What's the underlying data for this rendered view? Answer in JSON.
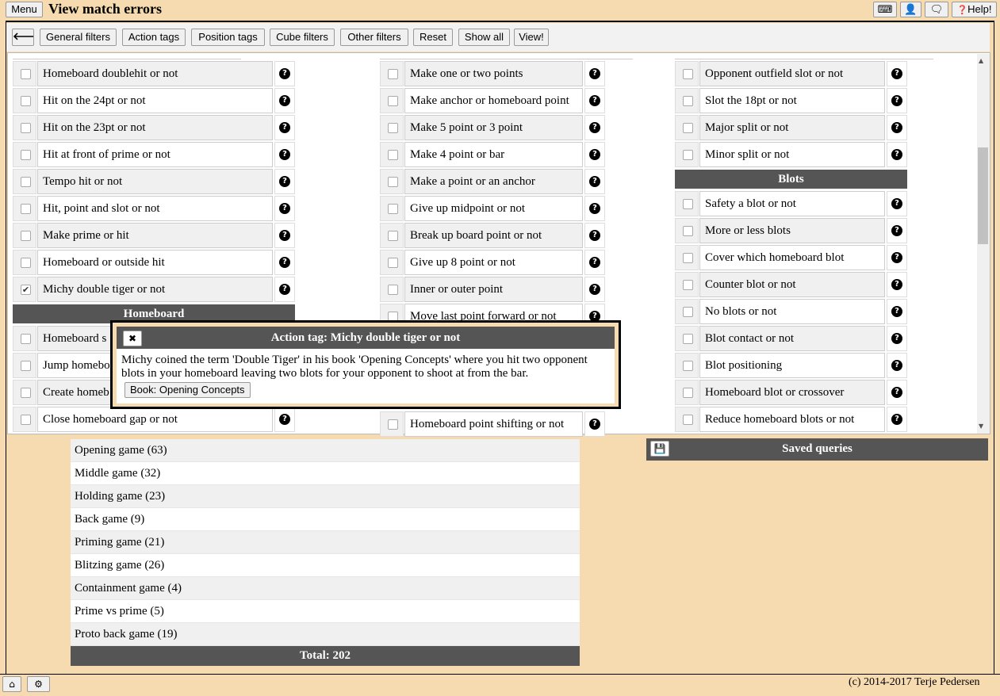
{
  "header": {
    "menu_label": "Menu",
    "title": "View match errors",
    "keyboard_icon": "keyboard-icon",
    "user_icon": "user-icon",
    "chat_icon": "chat-icon",
    "help_label": "Help!"
  },
  "toolbar": {
    "back_icon": "arrow-left-icon",
    "buttons": [
      "General filters",
      "Action tags",
      "Position tags",
      "Cube filters",
      "Other filters",
      "Reset",
      "Show all",
      "View!"
    ]
  },
  "col1": {
    "rows": [
      {
        "label": "Homeboard doublehit or not",
        "checked": false
      },
      {
        "label": "Hit on the 24pt or not",
        "checked": false
      },
      {
        "label": "Hit on the 23pt or not",
        "checked": false
      },
      {
        "label": "Hit at front of prime or not",
        "checked": false
      },
      {
        "label": "Tempo hit or not",
        "checked": false
      },
      {
        "label": "Hit, point and slot or not",
        "checked": false
      },
      {
        "label": "Make prime or hit",
        "checked": false
      },
      {
        "label": "Homeboard or outside hit",
        "checked": false
      },
      {
        "label": "Michy double tiger or not",
        "checked": true
      }
    ],
    "section": "Homeboard",
    "rows2": [
      {
        "label": "Homeboard s",
        "checked": false
      },
      {
        "label": "Jump homebo",
        "checked": false
      },
      {
        "label": "Create homeb",
        "checked": false
      },
      {
        "label": "Close homeboard gap or not",
        "checked": false
      }
    ]
  },
  "col2": {
    "rows": [
      {
        "label": "Make one or two points",
        "checked": false
      },
      {
        "label": "Make anchor or homeboard point",
        "checked": false
      },
      {
        "label": "Make 5 point or 3 point",
        "checked": false
      },
      {
        "label": "Make 4 point or bar",
        "checked": false
      },
      {
        "label": "Make a point or an anchor",
        "checked": false
      },
      {
        "label": "Give up midpoint or not",
        "checked": false
      },
      {
        "label": "Break up board point or not",
        "checked": false
      },
      {
        "label": "Give up 8 point or not",
        "checked": false
      },
      {
        "label": "Inner or outer point",
        "checked": false
      },
      {
        "label": "Move last point forward or not",
        "checked": false
      }
    ],
    "last": {
      "label": "Homeboard point shifting or not",
      "checked": false
    }
  },
  "col3": {
    "rows": [
      {
        "label": "Opponent outfield slot or not",
        "checked": false
      },
      {
        "label": "Slot the 18pt or not",
        "checked": false
      },
      {
        "label": "Major split or not",
        "checked": false
      },
      {
        "label": "Minor split or not",
        "checked": false
      }
    ],
    "section": "Blots",
    "rows2": [
      {
        "label": "Safety a blot or not",
        "checked": false
      },
      {
        "label": "More or less blots",
        "checked": false
      },
      {
        "label": "Cover which homeboard blot",
        "checked": false
      },
      {
        "label": "Counter blot or not",
        "checked": false
      },
      {
        "label": "No blots or not",
        "checked": false
      },
      {
        "label": "Blot contact or not",
        "checked": false
      },
      {
        "label": "Blot positioning",
        "checked": false
      },
      {
        "label": "Homeboard blot or crossover",
        "checked": false
      },
      {
        "label": "Reduce homeboard blots or not",
        "checked": false
      }
    ]
  },
  "popup": {
    "title": "Action tag: Michy double tiger or not",
    "text": "Michy coined the term 'Double Tiger' in his book 'Opening Concepts' where you hit two opponent blots in your homeboard leaving two blots for your opponent to shoot at from the bar.",
    "book_label": "Book: Opening Concepts"
  },
  "games": {
    "rows": [
      "Opening game (63)",
      "Middle game (32)",
      "Holding game (23)",
      "Back game (9)",
      "Priming game (21)",
      "Blitzing game (26)",
      "Containment game (4)",
      "Prime vs prime (5)",
      "Proto back game (19)"
    ],
    "total": "Total: 202"
  },
  "saved": {
    "title": "Saved queries"
  },
  "footer": {
    "copyright": "(c) 2014-2017 Terje Pedersen"
  }
}
